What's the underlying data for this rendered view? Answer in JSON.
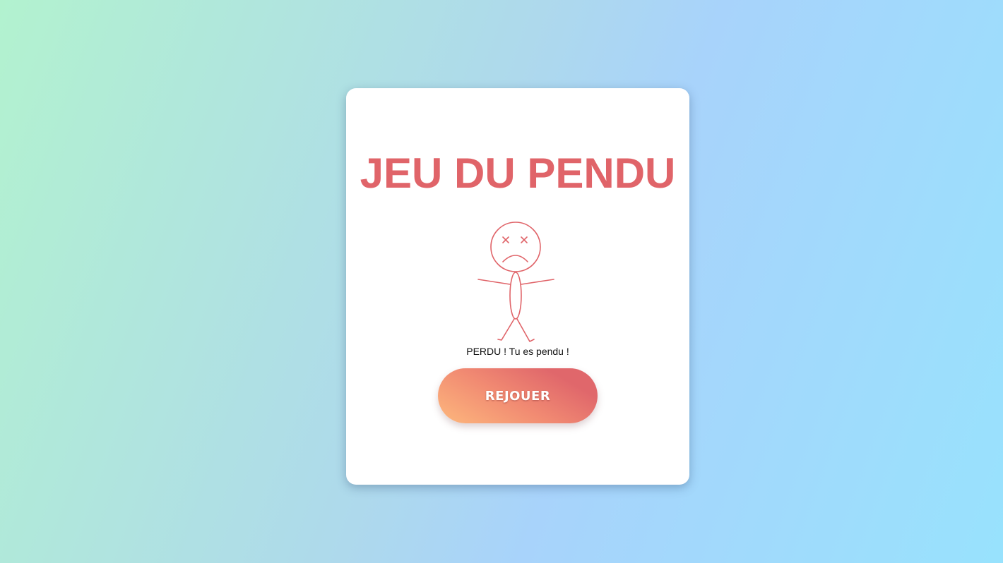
{
  "game": {
    "title": "JEU DU PENDU",
    "message": "PERDU ! Tu es pendu !",
    "replay_label": "REJOUER"
  },
  "figure": {
    "name": "hanged-stick-figure",
    "face": "dead-x-eyes-frown"
  },
  "colors": {
    "accent": "#e06469",
    "button_gradient_start": "#fdb87d",
    "button_gradient_end": "#e0676b",
    "background_start": "#b2f2cf",
    "background_end": "#98e2fd",
    "card": "#ffffff"
  }
}
